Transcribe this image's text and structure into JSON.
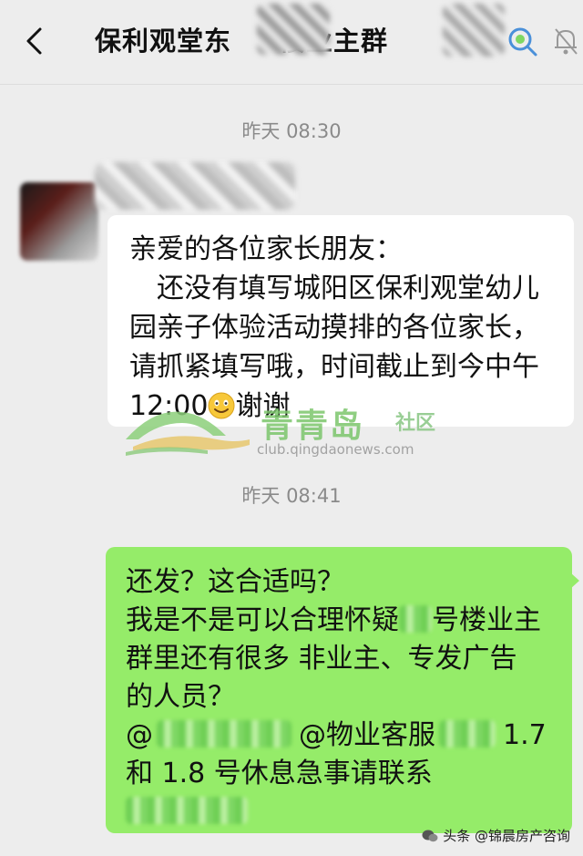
{
  "header": {
    "title_part1": "保利观堂东",
    "title_part2": "楼业主群",
    "back_icon": "chevron-left-icon",
    "search_icon": "search-icon",
    "mute_icon": "bell-muted-icon"
  },
  "messages": [
    {
      "timestamp": "昨天 08:30",
      "sender": "other",
      "lines": [
        "亲爱的各位家长朋友：",
        "还没有填写城阳区保利观堂幼儿",
        "园亲子体验活动摸排的各位家长，",
        "请抓紧填写哦，时间截止到今中午",
        "12:00",
        "谢谢"
      ],
      "emoji": "smiley-face-icon"
    },
    {
      "timestamp": "昨天 08:41",
      "sender": "self",
      "lines": [
        "还发？这合适吗？",
        "我是不是可以合理怀疑",
        "号楼业主",
        "群里还有很多 非业主、专发广告",
        "的人员？",
        "@",
        "@物业客服",
        "1.7",
        "和 1.8 号休息急事请联系"
      ]
    }
  ],
  "watermark": {
    "brand": "青青岛",
    "suffix": "社区",
    "url": "club.qingdaonews.com"
  },
  "credit": {
    "text": "头条 @锦晨房产咨询"
  },
  "colors": {
    "background": "#ededed",
    "self_bubble": "#95ec69",
    "other_bubble": "#ffffff",
    "timestamp": "#8a8a8a",
    "watermark_green": "#7cc66c"
  }
}
